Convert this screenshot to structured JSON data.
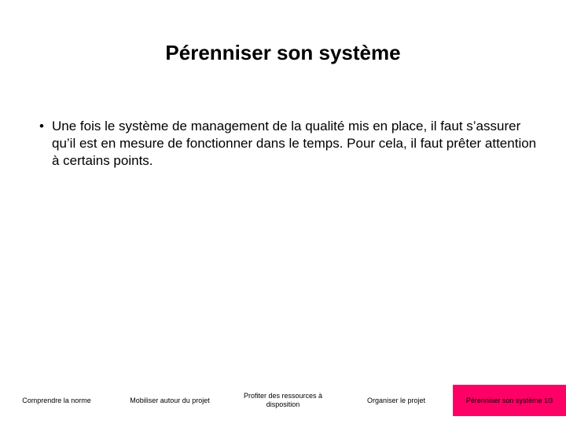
{
  "title": "Pérenniser son système",
  "bullet": {
    "text": "Une fois le système de management de la qualité mis en place, il faut s’assurer qu’il est en mesure de fonctionner dans le temps. Pour cela, il faut prêter attention à certains points."
  },
  "nav": {
    "items": [
      {
        "label": "Comprendre la norme"
      },
      {
        "label": "Mobiliser autour du projet"
      },
      {
        "label": "Profiter des ressources à disposition"
      },
      {
        "label": "Organiser le projet"
      }
    ],
    "current": {
      "label": "Pérenniser son système",
      "page": "1/3"
    }
  }
}
